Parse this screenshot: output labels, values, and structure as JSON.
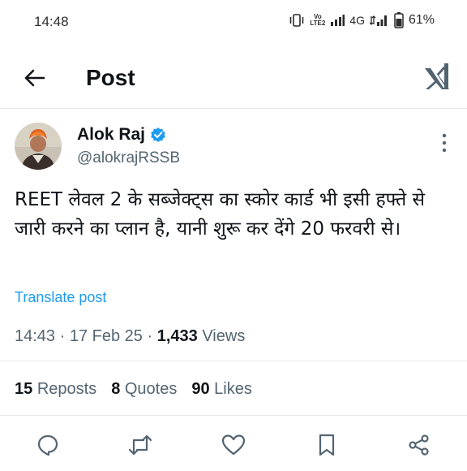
{
  "status_bar": {
    "time": "14:48",
    "network_volte": "Vo LTE1 LTE2",
    "network_type": "4G",
    "battery": "61%"
  },
  "header": {
    "title": "Post",
    "back_icon": "arrow-left-icon",
    "logo_icon": "x-logo-icon"
  },
  "post": {
    "author_name": "Alok Raj",
    "verified_icon": "verified-badge-icon",
    "author_handle": "@alokrajRSSB",
    "text": "REET लेवल 2 के सब्जेक्ट्स का स्कोर कार्ड भी इसी हफ्ते से जारी करने का प्लान है, यानी शुरू कर देंगे 20 फरवरी से।",
    "translate_label": "Translate post",
    "time": "14:43",
    "date": "17 Feb 25",
    "views_count": "1,433",
    "views_label": "Views"
  },
  "stats": {
    "reposts_count": "15",
    "reposts_label": "Reposts",
    "quotes_count": "8",
    "quotes_label": "Quotes",
    "likes_count": "90",
    "likes_label": "Likes"
  },
  "actions": [
    "reply-icon",
    "repost-icon",
    "like-icon",
    "bookmark-icon",
    "share-icon"
  ],
  "colors": {
    "link": "#1d9bf0",
    "text_primary": "#0f1419",
    "text_secondary": "#536471",
    "verified": "#1d9bf0"
  }
}
